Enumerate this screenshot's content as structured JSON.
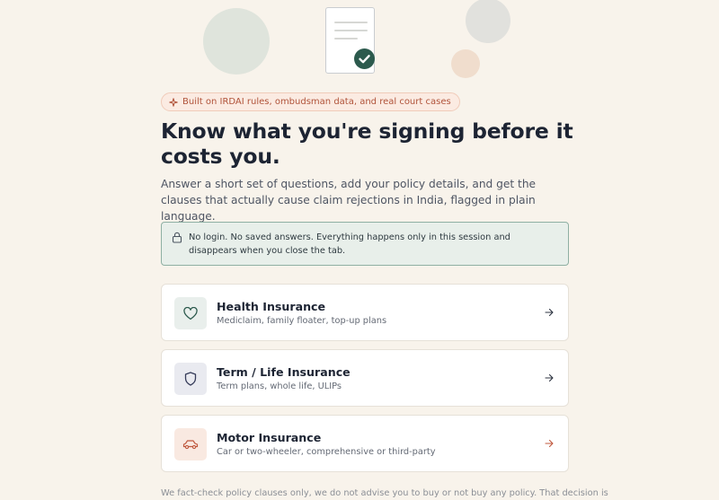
{
  "hero": {
    "icons": [
      "document-icon",
      "checkmark-icon"
    ],
    "badge_icon": "sparkle-icon",
    "badge_text": "Built on IRDAI rules, ombudsman data, and real court cases",
    "title": "Know what you're signing before it costs you.",
    "subtitle": "Answer a short set of questions, add your policy details, and get the clauses that actually cause claim rejections in India, flagged in plain language."
  },
  "privacy_notice": {
    "icon": "lock-icon",
    "text": "No login. No saved answers. Everything happens only in this session and disappears when you close the tab."
  },
  "options": [
    {
      "icon": "heart-icon",
      "title": "Health Insurance",
      "description": "Mediclaim, family floater, top-up plans"
    },
    {
      "icon": "shield-icon",
      "title": "Term / Life Insurance",
      "description": "Term plans, whole life, ULIPs"
    },
    {
      "icon": "car-icon",
      "title": "Motor Insurance",
      "description": "Car or two-wheeler, comprehensive or third-party"
    }
  ],
  "footnote": "We fact-check policy clauses only, we do not advise you to buy or not buy any policy. That decision is",
  "colors": {
    "background": "#f8f3eb",
    "accent_green": "#2c5a4d",
    "accent_orange": "#c0583e",
    "text_dark": "#1d2433"
  }
}
